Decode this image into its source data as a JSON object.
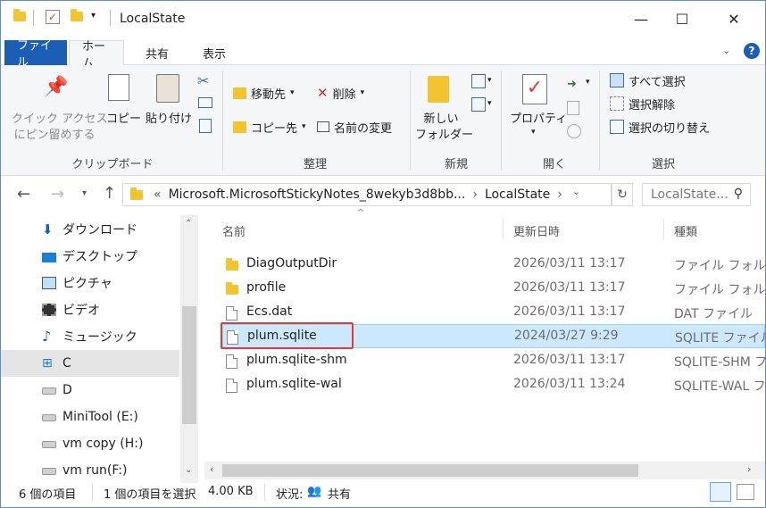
{
  "window": {
    "title": "LocalState",
    "controls": {
      "minimize": "—",
      "maximize": "☐",
      "close": "✕"
    }
  },
  "tabs": [
    {
      "label": "ファイル"
    },
    {
      "label": "ホーム"
    },
    {
      "label": "共有"
    },
    {
      "label": "表示"
    }
  ],
  "ribbon": {
    "clipboard": {
      "pin_label_1": "クイック アクセス",
      "pin_label_2": "にピン留めする",
      "copy": "コピー",
      "paste": "貼り付け",
      "group": "クリップボード"
    },
    "organize": {
      "move_to": "移動先",
      "copy_to": "コピー先",
      "delete": "削除",
      "rename": "名前の変更",
      "group": "整理"
    },
    "new": {
      "folder_1": "新しい",
      "folder_2": "フォルダー",
      "group": "新規"
    },
    "open": {
      "properties": "プロパティ",
      "group": "開く"
    },
    "select": {
      "select_all": "すべて選択",
      "select_none": "選択解除",
      "invert": "選択の切り替え",
      "group": "選択"
    }
  },
  "address": {
    "prefix": "«",
    "path1": "Microsoft.MicrosoftStickyNotes_8wekyb3d8bb...",
    "path2": "LocalState",
    "search_placeholder": "LocalState..."
  },
  "nav": {
    "items": [
      {
        "label": "ダウンロード",
        "icon": "download-icon"
      },
      {
        "label": "デスクトップ",
        "icon": "desktop-icon"
      },
      {
        "label": "ピクチャ",
        "icon": "pictures-icon"
      },
      {
        "label": "ビデオ",
        "icon": "video-icon"
      },
      {
        "label": "ミュージック",
        "icon": "music-icon"
      },
      {
        "label": "C",
        "icon": "windows-drive-icon"
      },
      {
        "label": "D",
        "icon": "drive-icon"
      },
      {
        "label": "MiniTool (E:)",
        "icon": "drive-icon"
      },
      {
        "label": "vm copy (H:)",
        "icon": "drive-icon"
      },
      {
        "label": "vm run(F:)",
        "icon": "drive-icon"
      }
    ]
  },
  "columns": {
    "name": "名前",
    "date": "更新日時",
    "type": "種類"
  },
  "files": [
    {
      "name": "DiagOutputDir",
      "date": "2026/03/11 13:17",
      "type": "ファイル フォルダー",
      "kind": "folder"
    },
    {
      "name": "profile",
      "date": "2026/03/11 13:17",
      "type": "ファイル フォルダー",
      "kind": "folder"
    },
    {
      "name": "Ecs.dat",
      "date": "2026/03/11 13:17",
      "type": "DAT ファイル",
      "kind": "file"
    },
    {
      "name": "plum.sqlite",
      "date": "2024/03/27 9:29",
      "type": "SQLITE ファイル",
      "kind": "file"
    },
    {
      "name": "plum.sqlite-shm",
      "date": "2026/03/11 13:17",
      "type": "SQLITE-SHM ファイル",
      "kind": "file"
    },
    {
      "name": "plum.sqlite-wal",
      "date": "2026/03/11 13:24",
      "type": "SQLITE-WAL ファ",
      "kind": "file"
    }
  ],
  "status": {
    "count": "6 個の項目",
    "selected": "1 個の項目を選択",
    "size": "4.00 KB",
    "state": "状況:",
    "shared": "共有"
  },
  "colors": {
    "accent": "#1a5fb4",
    "selection": "#cce8ff",
    "highlight": "#e53935",
    "folder": "#f4c430"
  }
}
